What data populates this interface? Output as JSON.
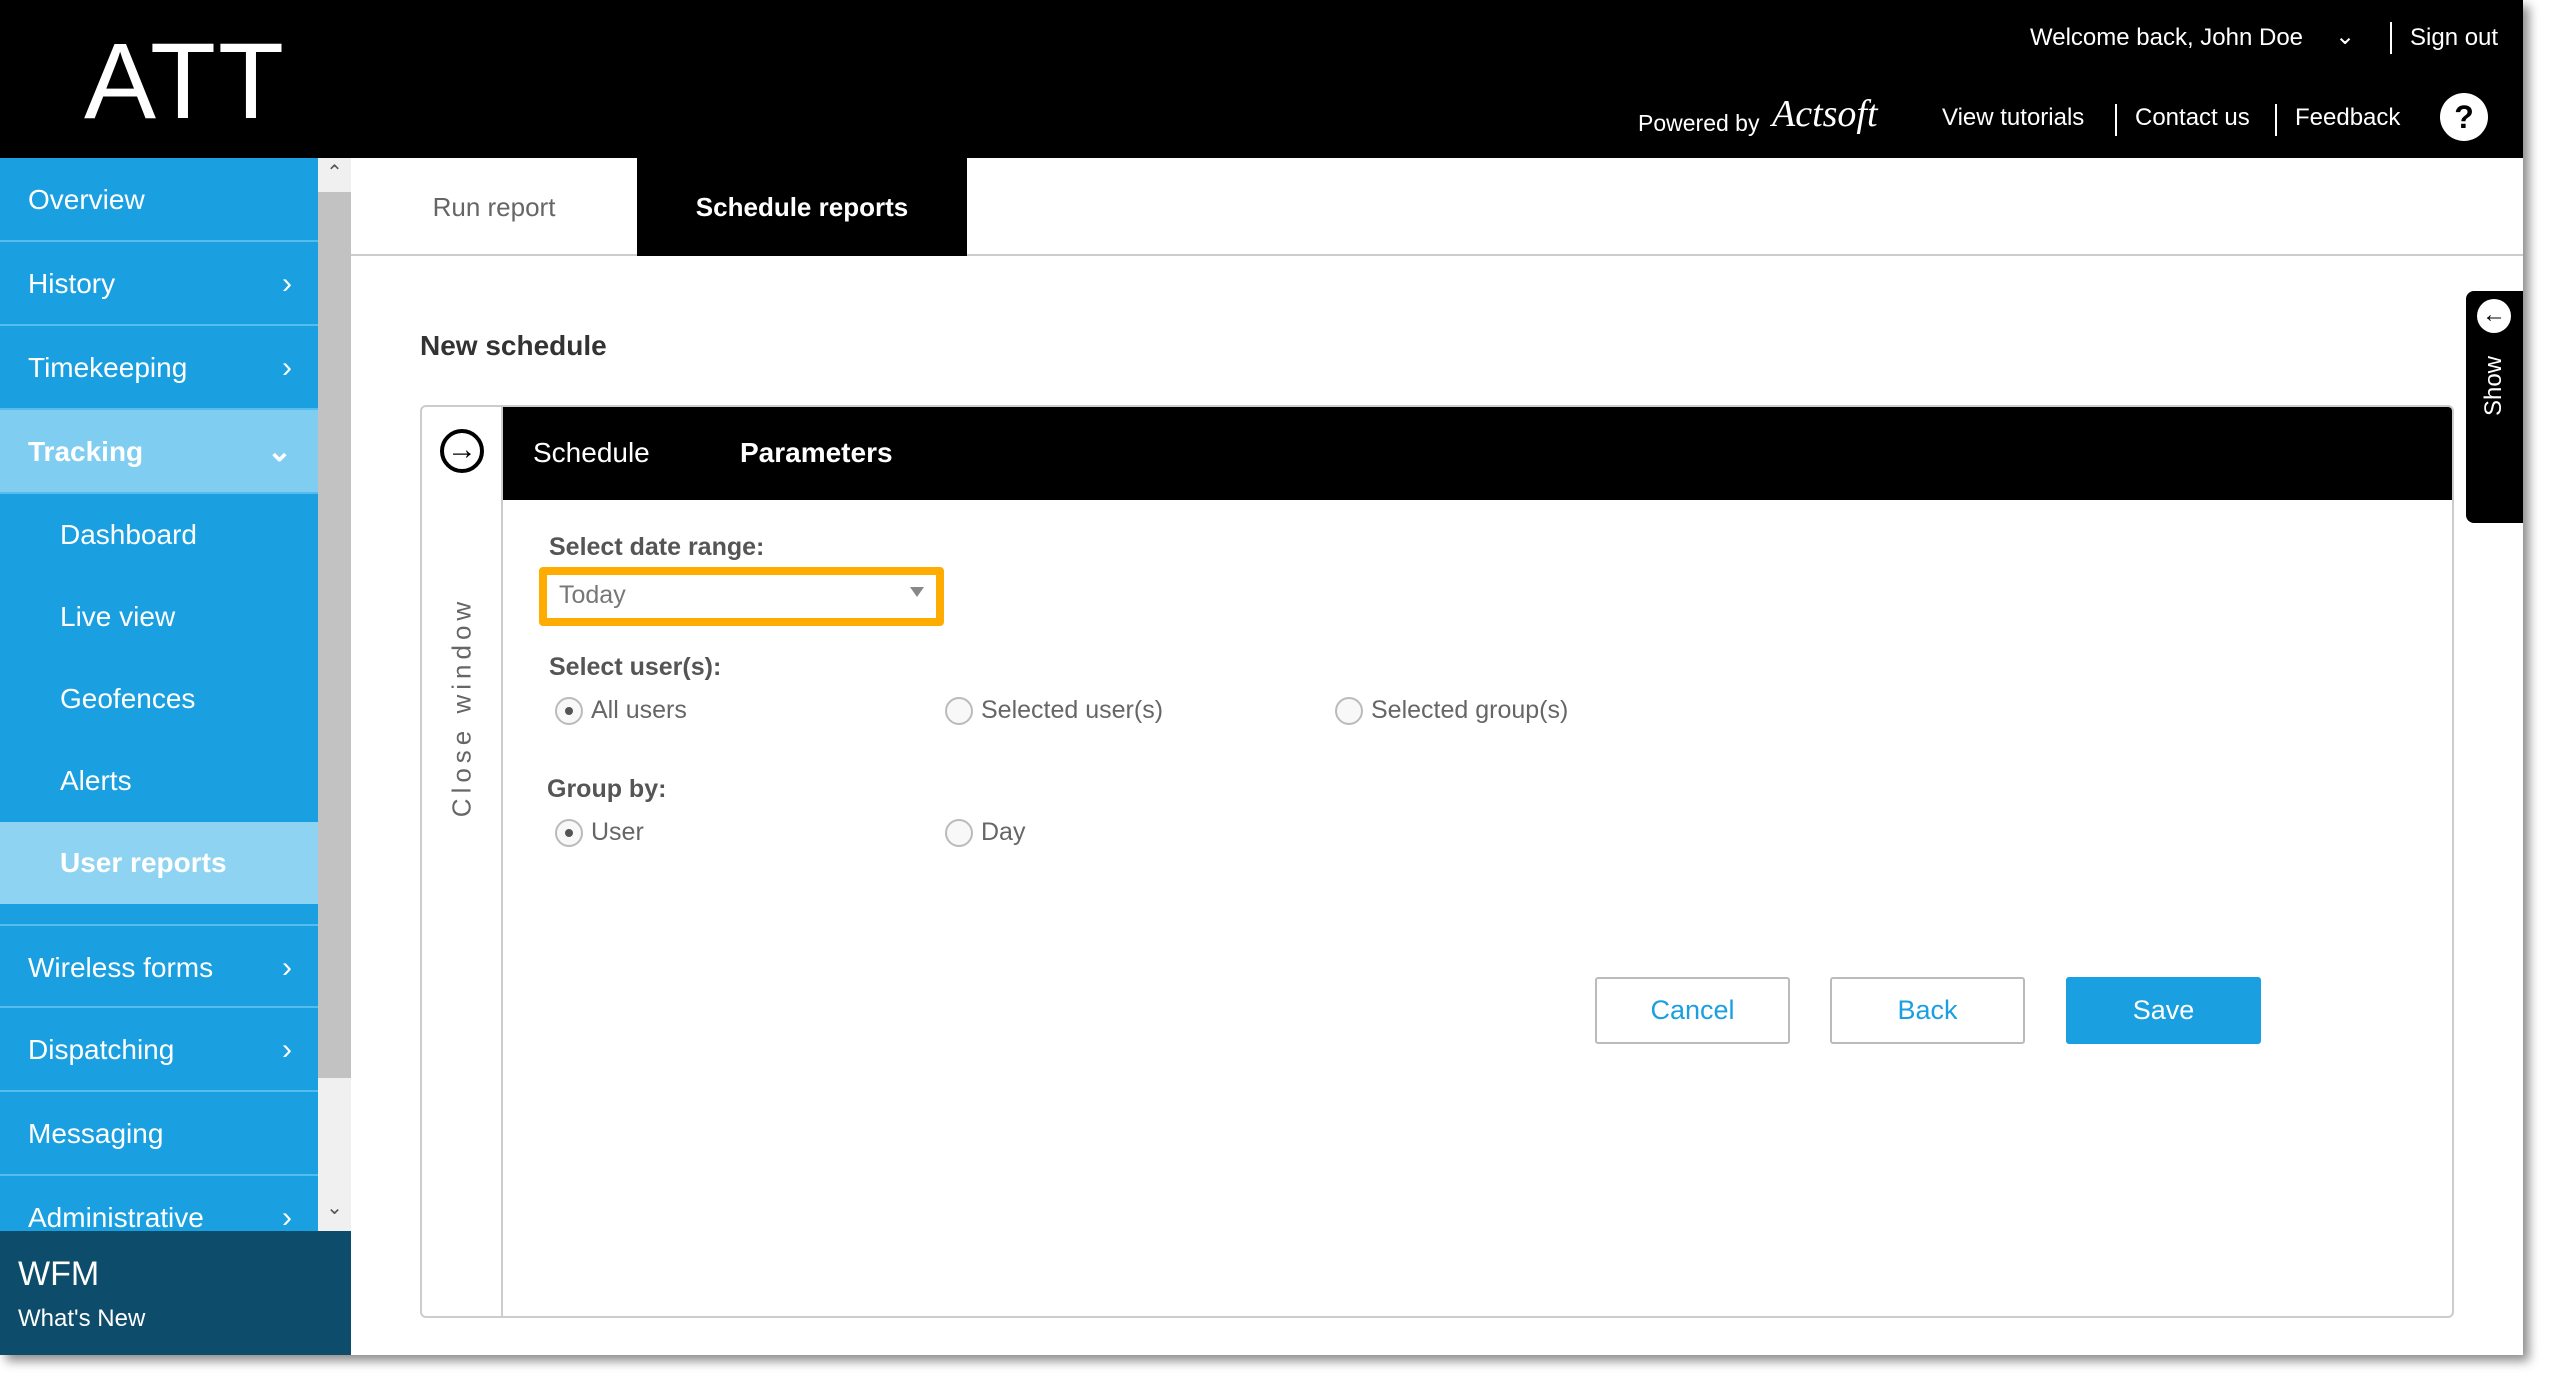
{
  "header": {
    "logo": "ATT",
    "welcome": "Welcome back, John Doe",
    "sign_out": "Sign out",
    "powered_by": "Powered by",
    "brand": "Actsoft",
    "view_tutorials": "View tutorials",
    "contact_us": "Contact us",
    "feedback": "Feedback",
    "help": "?"
  },
  "sidebar": {
    "items": [
      {
        "label": "Overview"
      },
      {
        "label": "History"
      },
      {
        "label": "Timekeeping"
      },
      {
        "label": "Tracking"
      },
      {
        "label": "Wireless forms"
      },
      {
        "label": "Dispatching"
      },
      {
        "label": "Messaging"
      },
      {
        "label": "Administrative"
      }
    ],
    "subitems": [
      {
        "label": "Dashboard"
      },
      {
        "label": "Live view"
      },
      {
        "label": "Geofences"
      },
      {
        "label": "Alerts"
      },
      {
        "label": "User reports"
      }
    ],
    "footer_title": "WFM",
    "footer_link": "What's New"
  },
  "tabs": [
    {
      "label": "Run report"
    },
    {
      "label": "Schedule reports"
    }
  ],
  "page_title": "New schedule",
  "panel": {
    "close_label": "Close window",
    "tabs": [
      {
        "label": "Schedule"
      },
      {
        "label": "Parameters"
      }
    ],
    "date_range_label": "Select date range:",
    "date_range_value": "Today",
    "users_label": "Select user(s):",
    "users_options": [
      "All users",
      "Selected user(s)",
      "Selected group(s)"
    ],
    "users_selected": "All users",
    "group_label": "Group by:",
    "group_options": [
      "User",
      "Day"
    ],
    "group_selected": "User",
    "cancel": "Cancel",
    "back": "Back",
    "save": "Save"
  },
  "show_label": "Show",
  "colors": {
    "accent": "#1a9fe0",
    "highlight": "#ffac00",
    "footer": "#0d4d6b"
  }
}
